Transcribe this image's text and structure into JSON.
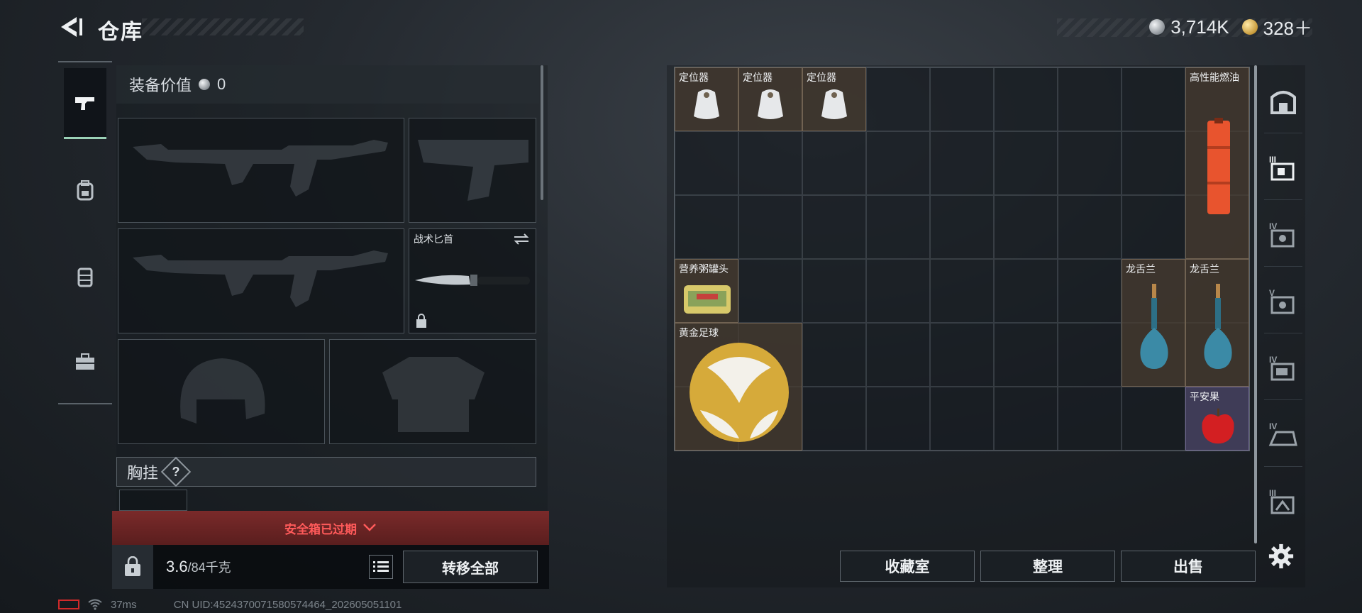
{
  "header": {
    "title": "仓库",
    "back_icon": "back-arrow-icon",
    "currencies": [
      {
        "icon": "silver-coin-icon",
        "value": "3,714K"
      },
      {
        "icon": "gold-coin-icon",
        "value": "328＋"
      }
    ]
  },
  "left_tabs": [
    {
      "name": "weapons",
      "icon": "pistol-icon",
      "active": true
    },
    {
      "name": "gear",
      "icon": "backpack-icon",
      "active": false
    },
    {
      "name": "rig",
      "icon": "vest-icon",
      "active": false
    },
    {
      "name": "case",
      "icon": "toolbox-icon",
      "active": false
    }
  ],
  "equipment": {
    "value_label": "装备价值",
    "value": "0",
    "melee_label": "战术匕首",
    "chest_label": "胸挂",
    "chest_badge": "?",
    "expired_text": "安全箱已过期",
    "weight_current": "3.6",
    "weight_max": "/84千克",
    "transfer_label": "转移全部"
  },
  "grid_items": [
    {
      "label": "定位器"
    },
    {
      "label": "定位器"
    },
    {
      "label": "定位器"
    },
    {
      "label": "高性能燃油"
    },
    {
      "label": "营养粥罐头"
    },
    {
      "label": "龙舌兰"
    },
    {
      "label": "龙舌兰"
    },
    {
      "label": "黄金足球"
    },
    {
      "label": "平安果"
    }
  ],
  "right_tabs": [
    {
      "label": "",
      "icon": "backpack-slot-icon"
    },
    {
      "label": "III",
      "icon": "case-tier-3-icon"
    },
    {
      "label": "IV",
      "icon": "case-tier-4-icon"
    },
    {
      "label": "V",
      "icon": "case-tier-5-icon"
    },
    {
      "label": "IV",
      "icon": "case-tier-4b-icon"
    },
    {
      "label": "IV",
      "icon": "case-tier-4c-icon"
    },
    {
      "label": "III",
      "icon": "case-tier-3b-icon"
    }
  ],
  "bottom_buttons": {
    "collection": "收藏室",
    "organize": "整理",
    "sell": "出售"
  },
  "status_bar": {
    "ping": "37ms",
    "uid": "CN UID:4524370071580574464_202605051101"
  },
  "colors": {
    "accent_active": "#9ad1b6",
    "warning_red": "#ff5a5a",
    "item_brown": "#483c30",
    "item_purple": "#464260"
  }
}
